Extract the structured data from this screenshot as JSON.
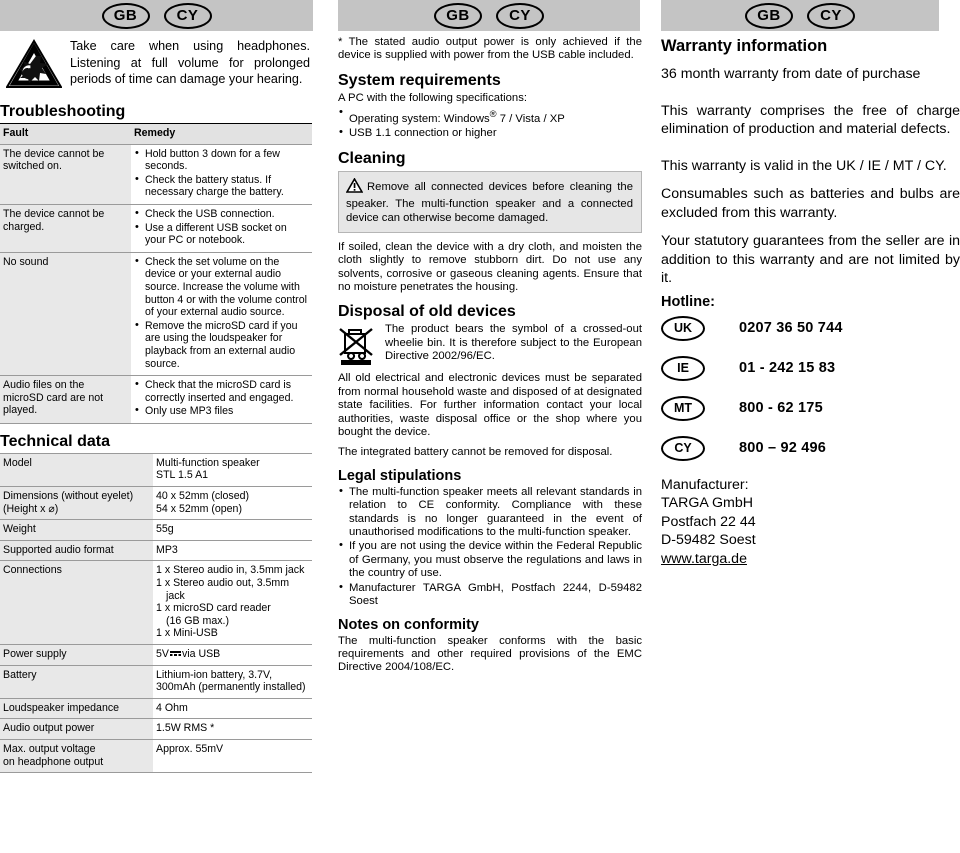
{
  "country_badges": [
    "GB",
    "CY"
  ],
  "column1": {
    "headphone_warning": {
      "icon": "headphone-volume-warning-triangle",
      "text": "Take care when using headphones. Listening at full volume for prolonged periods of time can damage your hearing."
    },
    "troubleshooting": {
      "heading": "Troubleshooting",
      "columns": [
        "Fault",
        "Remedy"
      ],
      "rows": [
        {
          "fault": "The device cannot be switched on.",
          "remedy": [
            "Hold button 3 down for a few seconds.",
            "Check the battery status. If necessary charge the battery."
          ]
        },
        {
          "fault": "The device cannot be charged.",
          "remedy": [
            "Check the USB connection.",
            "Use a different USB socket on your PC or notebook."
          ]
        },
        {
          "fault": "No sound",
          "remedy": [
            "Check the set volume on the device or your external audio source. Increase the volume with button 4 or with the volume control of your external audio source.",
            "Remove the microSD card if you are using the loudspeaker for playback from an external audio source."
          ]
        },
        {
          "fault": "Audio files on the microSD card are not played.",
          "remedy": [
            "Check that the microSD card is correctly inserted and engaged.",
            "Only use MP3 files"
          ]
        }
      ]
    },
    "technical_data": {
      "heading": "Technical data",
      "rows": [
        {
          "label": "Model",
          "value": "Multi-function speaker\nSTL 1.5 A1"
        },
        {
          "label": "Dimensions (without eyelet)\n(Height x ⌀)",
          "value": "40 x 52mm (closed)\n54 x 52mm (open)"
        },
        {
          "label": "Weight",
          "value": "55g"
        },
        {
          "label": "Supported audio format",
          "value": "MP3"
        },
        {
          "label": "Connections",
          "value": "1 x Stereo audio in, 3.5mm jack\n1 x Stereo audio out, 3.5mm jack\n1 x microSD card reader (16 GB max.)\n1 x Mini-USB"
        },
        {
          "label": "Power supply",
          "value": "5V ⎓ via USB",
          "value_prefix": "5V",
          "value_suffix": "via USB",
          "symbol": "dc-voltage-symbol"
        },
        {
          "label": "Battery",
          "value": "Lithium-ion battery, 3.7V, 300mAh (permanently installed)"
        },
        {
          "label": "Loudspeaker impedance",
          "value": "4 Ohm"
        },
        {
          "label": "Audio output power",
          "value": "1.5W RMS *"
        },
        {
          "label": "Max. output voltage\non headphone output",
          "value": "Approx. 55mV"
        }
      ]
    }
  },
  "column2": {
    "footnote": "* The stated audio output power is only achieved if the device is supplied with power from the USB cable included.",
    "system_requirements": {
      "heading": "System requirements",
      "intro": "A PC with the following specifications:",
      "items": [
        "Operating system: Windows® 7 / Vista / XP",
        "USB 1.1 connection or higher"
      ]
    },
    "cleaning": {
      "heading": "Cleaning",
      "notice_icon": "warning-triangle-icon",
      "notice": "Remove all connected devices before cleaning the speaker. The multi-function speaker and a connected device can otherwise become damaged.",
      "body": "If soiled, clean the device with a dry cloth, and moisten the cloth slightly to remove stubborn dirt. Do not use any solvents, corrosive or gaseous cleaning agents. Ensure that no moisture penetrates the housing."
    },
    "disposal": {
      "heading": "Disposal of old devices",
      "icon": "crossed-out-wheelie-bin-icon",
      "icon_text": "The product bears the symbol of a crossed-out wheelie bin. It is therefore subject to the European Directive 2002/96/EC.",
      "paragraphs": [
        "All old electrical and electronic devices must be separated from normal household waste and disposed of at designated state facilities. For further information contact your local authorities, waste disposal office or the shop where you bought the device.",
        "The integrated battery cannot be removed for disposal."
      ]
    },
    "legal": {
      "heading": "Legal stipulations",
      "items": [
        "The multi-function speaker meets all relevant standards in relation to CE conformity. Compliance with these standards is no longer guaranteed in the event of unauthorised modifications to the multi-function speaker.",
        "If you are not using the device within the Federal Republic of Germany, you must observe the regulations and laws in the country of use.",
        "Manufacturer TARGA GmbH, Postfach 2244, D-59482 Soest"
      ]
    },
    "conformity": {
      "heading": "Notes on conformity",
      "body": "The multi-function speaker conforms with the basic requirements and other required provisions of the EMC Directive 2004/108/EC."
    }
  },
  "column3": {
    "heading": "Warranty information",
    "paragraphs": [
      "36 month warranty from date of purchase",
      "This warranty comprises the free of charge elimination of production and material defects.",
      "This warranty is valid in the UK / IE / MT / CY.",
      "Consumables such as batteries and bulbs are excluded from this warranty.",
      "Your statutory guarantees from the seller are in addition to this warranty and are not limited by it."
    ],
    "hotline_label": "Hotline:",
    "hotlines": [
      {
        "country": "UK",
        "number": "0207 36 50 744"
      },
      {
        "country": "IE",
        "number": "01 - 242 15 83"
      },
      {
        "country": "MT",
        "number": "800 - 62 175"
      },
      {
        "country": "CY",
        "number": "800 – 92 496"
      }
    ],
    "manufacturer": {
      "label": "Manufacturer:",
      "name": "TARGA GmbH",
      "po_box": "Postfach 22 44",
      "city": "D-59482 Soest",
      "website": "www.targa.de"
    }
  }
}
